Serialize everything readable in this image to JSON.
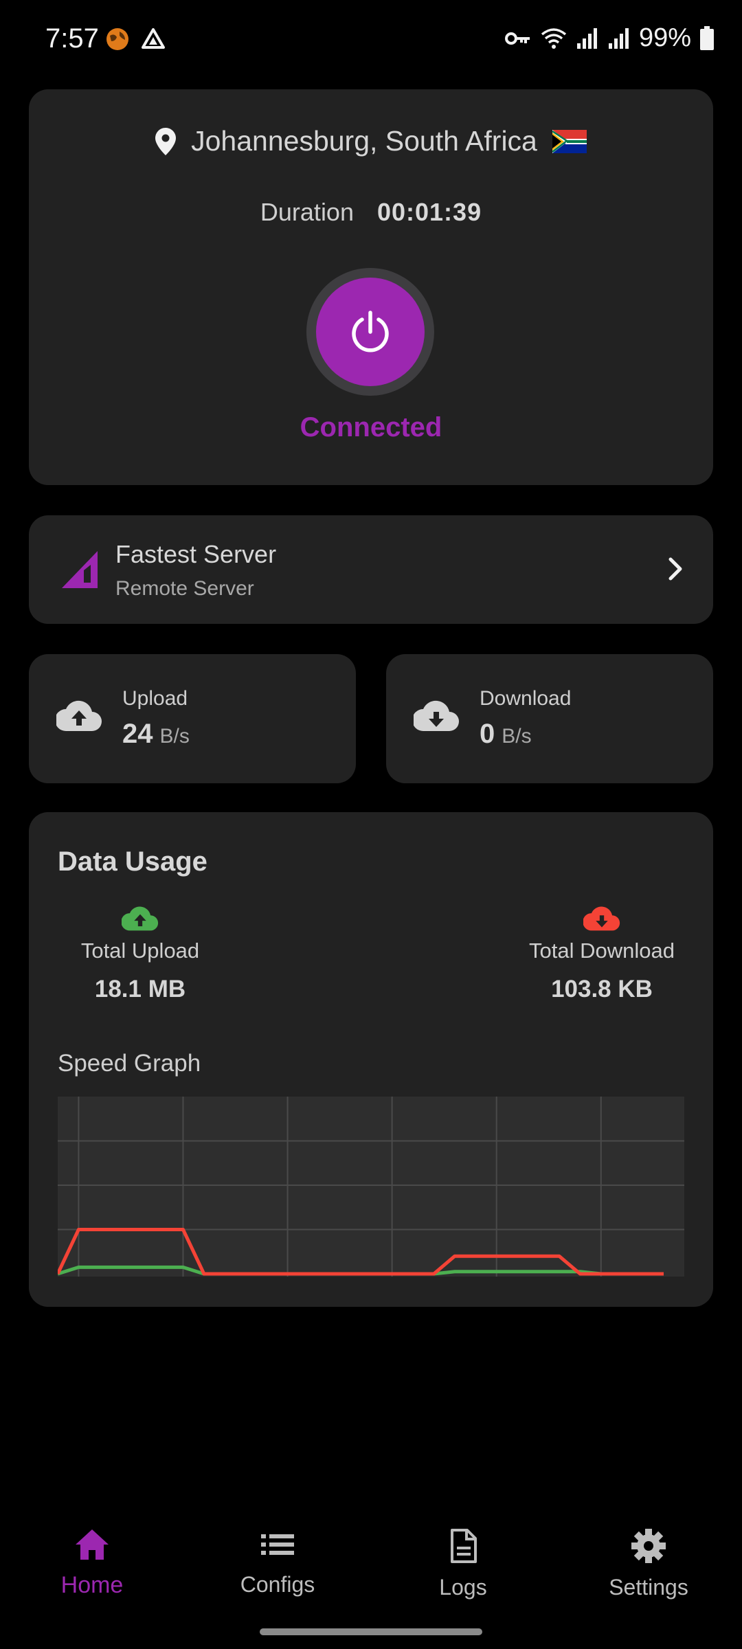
{
  "status_bar": {
    "time": "7:57",
    "battery": "99%",
    "icons": [
      "vpn-key-icon",
      "wifi-icon",
      "signal-icon",
      "signal-icon",
      "battery-icon"
    ]
  },
  "connection": {
    "location": "Johannesburg, South Africa",
    "duration_label": "Duration",
    "duration_value": "00:01:39",
    "status": "Connected"
  },
  "server": {
    "title": "Fastest Server",
    "subtitle": "Remote Server"
  },
  "speed": {
    "upload_label": "Upload",
    "upload_value": "24",
    "upload_unit": "B/s",
    "download_label": "Download",
    "download_value": "0",
    "download_unit": "B/s"
  },
  "usage": {
    "title": "Data Usage",
    "total_upload_label": "Total Upload",
    "total_upload_value": "18.1 MB",
    "total_download_label": "Total Download",
    "total_download_value": "103.8 KB",
    "graph_title": "Speed Graph"
  },
  "chart_data": {
    "type": "line",
    "title": "Speed Graph",
    "x": [
      0,
      1,
      2,
      3,
      4,
      5,
      6,
      7,
      8,
      9,
      10,
      11,
      12,
      13,
      14,
      15,
      16,
      17,
      18,
      19,
      20,
      21,
      22,
      23,
      24,
      25,
      26,
      27,
      28,
      29
    ],
    "series": [
      {
        "color": "#f44336",
        "values": [
          0,
          1,
          1,
          1,
          1,
          1,
          1,
          0,
          0,
          0,
          0,
          0,
          0,
          0,
          0,
          0,
          0,
          0,
          0,
          0.4,
          0.4,
          0.4,
          0.4,
          0.4,
          0.4,
          0,
          0,
          0,
          0,
          0
        ]
      },
      {
        "color": "#4caf50",
        "values": [
          0,
          0.15,
          0.15,
          0.15,
          0.15,
          0.15,
          0.15,
          0,
          0,
          0,
          0,
          0,
          0,
          0,
          0,
          0,
          0,
          0,
          0,
          0.05,
          0.05,
          0.05,
          0.05,
          0.05,
          0.05,
          0.05,
          0,
          0,
          0,
          0
        ]
      }
    ],
    "ylim": [
      0,
      4
    ],
    "grid": true
  },
  "nav": {
    "items": [
      {
        "label": "Home",
        "icon": "home-icon",
        "active": true
      },
      {
        "label": "Configs",
        "icon": "list-icon",
        "active": false
      },
      {
        "label": "Logs",
        "icon": "document-icon",
        "active": false
      },
      {
        "label": "Settings",
        "icon": "gear-icon",
        "active": false
      }
    ]
  },
  "colors": {
    "accent": "#9c27b0",
    "card": "#222222",
    "upload_green": "#4caf50",
    "download_red": "#f44336"
  }
}
